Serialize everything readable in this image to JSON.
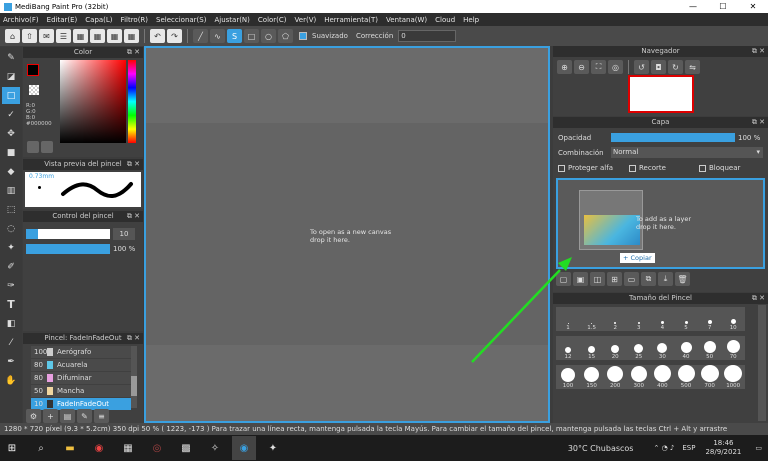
{
  "window": {
    "title": "MediBang Paint Pro (32bit)",
    "minimize": "—",
    "maximize": "☐",
    "close": "✕"
  },
  "menu": [
    "Archivo(F)",
    "Editar(E)",
    "Capa(L)",
    "Filtro(R)",
    "Seleccionar(S)",
    "Ajustar(N)",
    "Color(C)",
    "Ver(V)",
    "Herramienta(T)",
    "Ventana(W)",
    "Cloud",
    "Help"
  ],
  "toolbar": {
    "smooth_label": "Suavizado",
    "correction_label": "Corrección",
    "correction_value": "0"
  },
  "color_panel": {
    "title": "Color",
    "r": "R:0",
    "g": "G:0",
    "b": "B:0",
    "hex": "#000000"
  },
  "brush_preview": {
    "title": "Vista previa del pincel",
    "size": "0.73mm"
  },
  "brush_control": {
    "title": "Control del pincel",
    "size_value": "10",
    "opacity_value": "100 %"
  },
  "brush_list": {
    "title": "Pincel: FadeInFadeOut",
    "items": [
      {
        "size": "100",
        "name": "Aerógrafo",
        "color": "#cccccc"
      },
      {
        "size": "80",
        "name": "Acuarela",
        "color": "#5fc8e8"
      },
      {
        "size": "80",
        "name": "Difuminar",
        "color": "#e8a0e0"
      },
      {
        "size": "50",
        "name": "Mancha",
        "color": "#f0d6a0"
      },
      {
        "size": "10",
        "name": "FadeInFadeOut",
        "color": "#333333"
      }
    ]
  },
  "canvas": {
    "hint_line1": "To open as a new canvas",
    "hint_line2": "drop it here."
  },
  "navigator": {
    "title": "Navegador"
  },
  "layer_panel": {
    "title": "Capa",
    "opacity_label": "Opacidad",
    "opacity_value": "100 %",
    "blend_label": "Combinación",
    "blend_value": "Normal",
    "protect_alpha": "Proteger alfa",
    "clip": "Recorte",
    "lock": "Bloquear",
    "drop_line1": "To add as a layer",
    "drop_line2": "drop it here.",
    "copy_label": "+ Copiar"
  },
  "brush_size": {
    "title": "Tamaño del Pincel",
    "sizes": [
      "1",
      "1.5",
      "2",
      "3",
      "4",
      "5",
      "7",
      "10",
      "12",
      "15",
      "20",
      "25",
      "30",
      "40",
      "50",
      "70",
      "100",
      "150",
      "200",
      "300",
      "400",
      "500",
      "700",
      "1000"
    ]
  },
  "status": {
    "text": "1280 * 720 píxel   (9.3 * 5.2cm)   350 dpi   50 %   ( 1223, -173 )   Para trazar una línea recta, mantenga pulsada la tecla Mayús. Para cambiar el tamaño del pincel, mantenga pulsada las teclas Ctrl + Alt y arrastre"
  },
  "taskbar": {
    "weather": "30°C  Chubascos",
    "lang": "ESP",
    "time": "18:46",
    "date": "28/9/2021"
  },
  "colors": {
    "accent": "#3aa0e0",
    "arrow": "#22dd22"
  }
}
